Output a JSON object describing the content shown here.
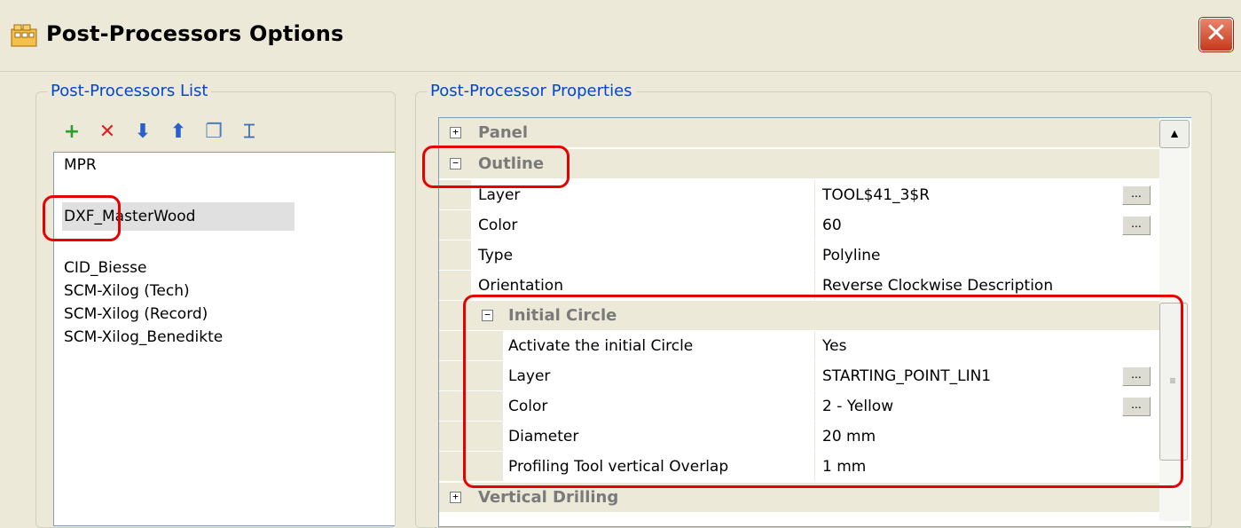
{
  "window": {
    "title": "Post-Processors Options",
    "close_symbol": "✕"
  },
  "left_group": {
    "legend": "Post-Processors List",
    "toolbar": [
      {
        "icon": "add-icon",
        "glyph": "+",
        "color": "#2f9c2f"
      },
      {
        "icon": "delete-icon",
        "glyph": "✕",
        "color": "#e02020"
      },
      {
        "icon": "move-down-icon",
        "glyph": "⬇",
        "color": "#2a5fd0"
      },
      {
        "icon": "move-up-icon",
        "glyph": "⬆",
        "color": "#2a5fd0"
      },
      {
        "icon": "copy-icon",
        "glyph": "❐",
        "color": "#4f7fb4"
      },
      {
        "icon": "rename-icon",
        "glyph": "⌶",
        "color": "#3a6fb4"
      }
    ],
    "items": [
      "MPR",
      "DXF_MasterWood",
      "CID_Biesse",
      "SCM-Xilog (Tech)",
      "SCM-Xilog (Record)",
      "SCM-Xilog_Benedikte"
    ],
    "selected": "DXF_MasterWood"
  },
  "right_group": {
    "legend": "Post-Processor Properties",
    "categories": {
      "panel": "Panel",
      "outline": "Outline",
      "initial_circle": "Initial Circle",
      "vertical_drilling": "Vertical Drilling"
    },
    "outline_props": [
      {
        "name": "Layer",
        "value": "TOOL$41_3$R",
        "button": true
      },
      {
        "name": "Color",
        "value": "60",
        "button": true
      },
      {
        "name": "Type",
        "value": "Polyline",
        "button": false
      },
      {
        "name": "Orientation",
        "value": "Reverse Clockwise Description",
        "button": false
      }
    ],
    "circle_props": [
      {
        "name": "Activate the initial Circle",
        "value": "Yes",
        "button": false
      },
      {
        "name": "Layer",
        "value": "STARTING_POINT_LIN1",
        "button": true
      },
      {
        "name": "Color",
        "value": "2 - Yellow",
        "button": true
      },
      {
        "name": "Diameter",
        "value": "20 mm",
        "button": false
      },
      {
        "name": "Profiling Tool vertical Overlap",
        "value": "1 mm",
        "button": false
      }
    ],
    "ellipsis": "...",
    "expand_plus": "+",
    "expand_minus": "−"
  },
  "colors": {
    "annotation": "#e60000",
    "legend": "#0046d5"
  }
}
